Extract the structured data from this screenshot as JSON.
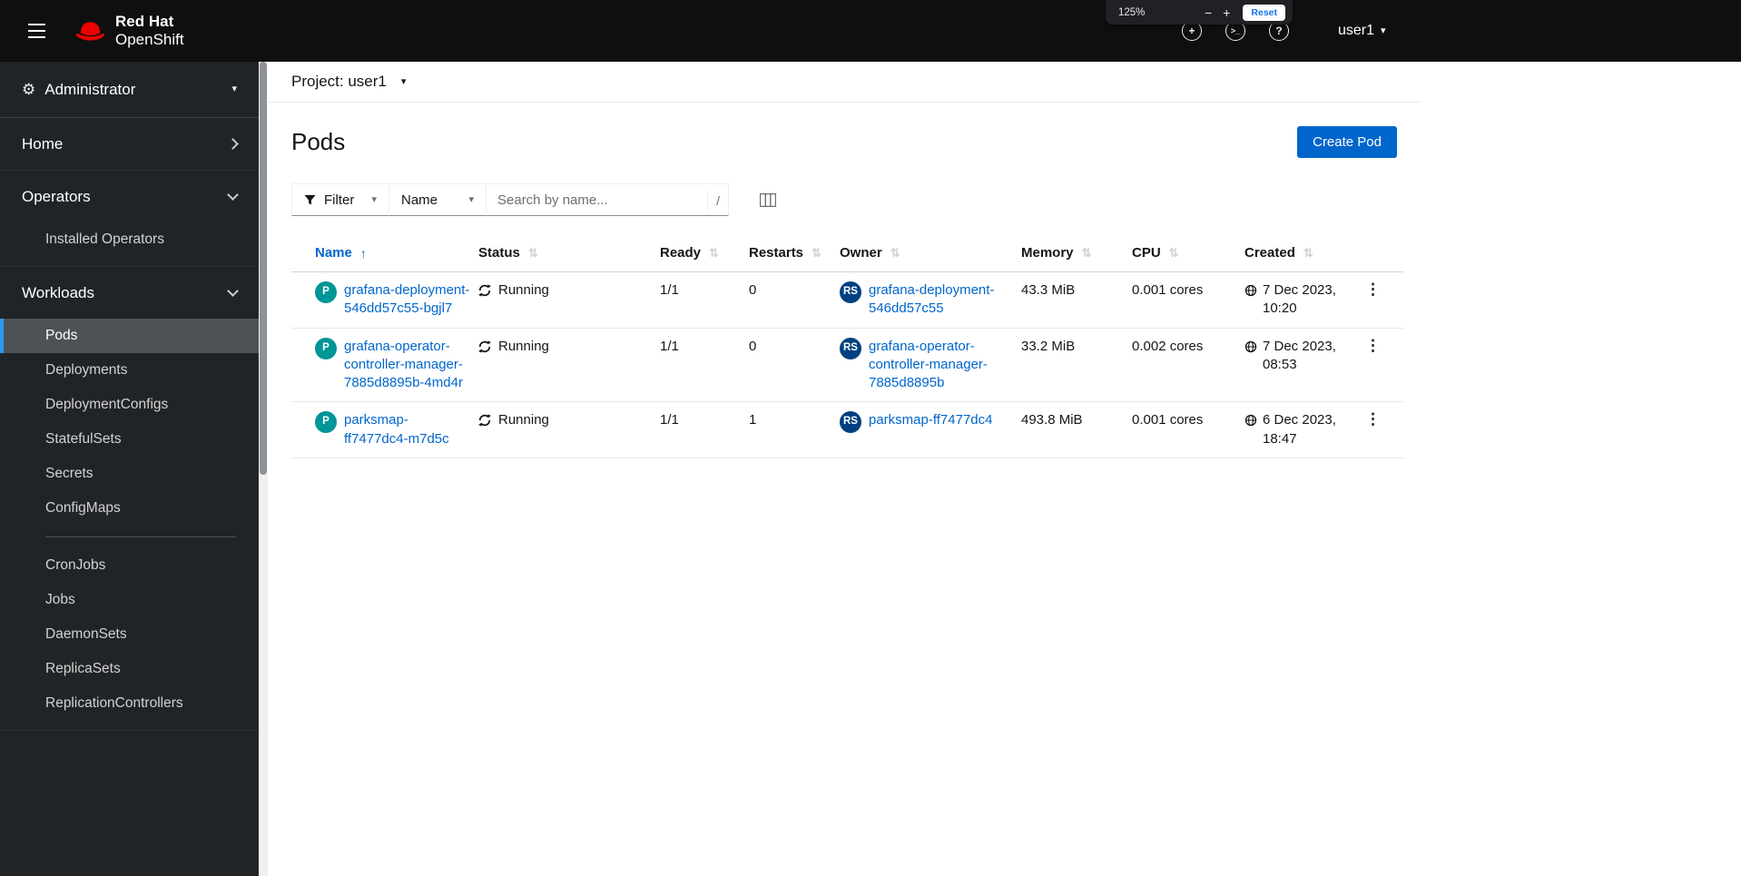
{
  "colors": {
    "brand_red": "#ee0000",
    "link_blue": "#0066cc",
    "primary_button": "#0066cc",
    "pod_badge": "#009596",
    "replicaset_badge": "#004080",
    "masthead_bg": "#0f0f0f",
    "sidebar_bg": "#212427",
    "sidebar_selected_bg": "#4f5255",
    "sidebar_selected_border": "#2b9af3"
  },
  "glyphs": {
    "caret_down": "▾",
    "kebab": "⋮",
    "sort_asc": "↑",
    "sort_both": "⇅",
    "gear": "⚙"
  },
  "masthead": {
    "brand_line1": "Red Hat",
    "brand_line2": "OpenShift",
    "username": "user1",
    "icons": [
      {
        "name": "quick-create-icon",
        "glyph": "+"
      },
      {
        "name": "terminal-icon",
        "glyph": ">_"
      },
      {
        "name": "help-icon",
        "glyph": "?"
      }
    ]
  },
  "zoom_popup": {
    "level": "125%",
    "minus": "−",
    "plus": "+",
    "reset": "Reset"
  },
  "sidebar": {
    "perspective": "Administrator",
    "home": "Home",
    "operators": "Operators",
    "operators_items": [
      "Installed Operators"
    ],
    "workloads": "Workloads",
    "workloads_items_top": [
      "Pods",
      "Deployments",
      "DeploymentConfigs",
      "StatefulSets",
      "Secrets",
      "ConfigMaps"
    ],
    "workloads_items_bottom": [
      "CronJobs",
      "Jobs",
      "DaemonSets",
      "ReplicaSets",
      "ReplicationControllers"
    ],
    "selected_item": "Pods"
  },
  "project_bar": {
    "label": "Project: user1"
  },
  "page": {
    "title": "Pods",
    "create_button": "Create Pod"
  },
  "toolbar": {
    "filter_label": "Filter",
    "attribute_label": "Name",
    "search_placeholder": "Search by name...",
    "search_shortcut": "/"
  },
  "table": {
    "columns": [
      "Name",
      "Status",
      "Ready",
      "Restarts",
      "Owner",
      "Memory",
      "CPU",
      "Created"
    ],
    "sorted_by": "Name",
    "sort_direction": "ascending",
    "rows": [
      {
        "badge": "P",
        "name": "grafana-deployment-546dd57c55-bgjl7",
        "status": "Running",
        "ready": "1/1",
        "restarts": "0",
        "owner_badge": "RS",
        "owner": "grafana-deployment-546dd57c55",
        "memory": "43.3 MiB",
        "cpu": "0.001 cores",
        "created": "7 Dec 2023, 10:20"
      },
      {
        "badge": "P",
        "name": "grafana-operator-controller-manager-7885d8895b-4md4r",
        "status": "Running",
        "ready": "1/1",
        "restarts": "0",
        "owner_badge": "RS",
        "owner": "grafana-operator-controller-manager-7885d8895b",
        "memory": "33.2 MiB",
        "cpu": "0.002 cores",
        "created": "7 Dec 2023, 08:53"
      },
      {
        "badge": "P",
        "name": "parksmap-ff7477dc4-m7d5c",
        "status": "Running",
        "ready": "1/1",
        "restarts": "1",
        "owner_badge": "RS",
        "owner": "parksmap-ff7477dc4",
        "memory": "493.8 MiB",
        "cpu": "0.001 cores",
        "created": "6 Dec 2023, 18:47"
      }
    ]
  }
}
